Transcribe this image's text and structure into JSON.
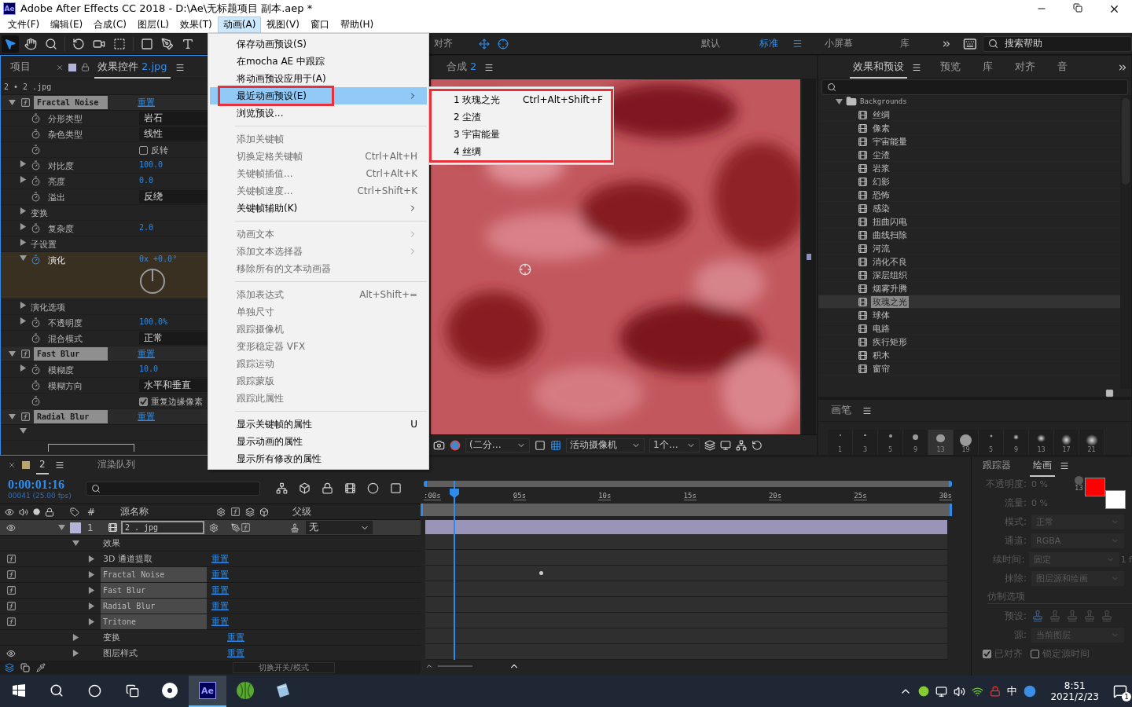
{
  "window": {
    "app_badge": "Ae",
    "title": "Adobe After Effects CC 2018 - D:\\Ae\\无标题项目 副本.aep *"
  },
  "menu_bar": [
    {
      "label": "文件(F)",
      "selected": false
    },
    {
      "label": "编辑(E)",
      "selected": false
    },
    {
      "label": "合成(C)",
      "selected": false
    },
    {
      "label": "图层(L)",
      "selected": false
    },
    {
      "label": "效果(T)",
      "selected": false
    },
    {
      "label": "动画(A)",
      "selected": true
    },
    {
      "label": "视图(V)",
      "selected": false
    },
    {
      "label": "窗口",
      "selected": false
    },
    {
      "label": "帮助(H)",
      "selected": false
    }
  ],
  "toolbar": {
    "workspaces": [
      {
        "label": "默认",
        "selected": false
      },
      {
        "label": "标准",
        "selected": true
      },
      {
        "label": "小屏幕",
        "selected": false
      },
      {
        "label": "库",
        "selected": false
      }
    ],
    "search": {
      "placeholder": "搜索帮助"
    }
  },
  "effect_controls": {
    "tabs": [
      {
        "label": "项目",
        "selected": false
      },
      {
        "label": "效果控件",
        "target": "2.jpg",
        "selected": true
      }
    ],
    "breadcrumb": "2 • 2 .jpg",
    "effects": [
      {
        "name": "Fractal Noise",
        "reset": "重置",
        "props": [
          {
            "kind": "dropdown",
            "label": "分形类型",
            "value": "岩石",
            "stopwatch": true,
            "selected": false
          },
          {
            "kind": "dropdown",
            "label": "杂色类型",
            "value": "线性",
            "stopwatch": true,
            "selected": false
          },
          {
            "kind": "checkbox",
            "value": "反转",
            "checked": false,
            "stopwatch": true,
            "selected": false
          },
          {
            "kind": "number",
            "label": "对比度",
            "value": "100.0",
            "expanded": false,
            "stopwatch": true,
            "selected": false
          },
          {
            "kind": "number",
            "label": "亮度",
            "value": "0.0",
            "expanded": false,
            "stopwatch": true,
            "selected": false
          },
          {
            "kind": "dropdown",
            "label": "溢出",
            "value": "反绕",
            "stopwatch": true,
            "selected": false
          },
          {
            "kind": "group",
            "label": "变换",
            "expanded": false,
            "stopwatch": false,
            "selected": false
          },
          {
            "kind": "number",
            "label": "复杂度",
            "value": "2.0",
            "expanded": false,
            "stopwatch": true,
            "selected": false
          },
          {
            "kind": "group",
            "label": "子设置",
            "expanded": false,
            "stopwatch": false,
            "selected": false
          },
          {
            "kind": "angle",
            "label": "演化",
            "value": "0x +0.0°",
            "expanded": true,
            "stopwatch": true,
            "selected": true
          },
          {
            "kind": "group",
            "label": "演化选项",
            "expanded": false,
            "stopwatch": false,
            "selected": false
          },
          {
            "kind": "number",
            "label": "不透明度",
            "value": "100.0%",
            "expanded": false,
            "stopwatch": true,
            "selected": false
          },
          {
            "kind": "dropdown",
            "label": "混合模式",
            "value": "正常",
            "stopwatch": true,
            "selected": false
          }
        ]
      },
      {
        "name": "Fast Blur",
        "reset": "重置",
        "props": [
          {
            "kind": "number",
            "label": "模糊度",
            "value": "10.0",
            "expanded": false,
            "stopwatch": true,
            "selected": false
          },
          {
            "kind": "dropdown",
            "label": "模糊方向",
            "value": "水平和垂直",
            "stopwatch": true,
            "selected": false
          },
          {
            "kind": "checkbox",
            "value": "重复边缘像素",
            "checked": true,
            "stopwatch": true,
            "selected": false
          }
        ]
      },
      {
        "name": "Radial Blur",
        "reset": "重置",
        "props": [
          {
            "kind": "widget",
            "expanded": true,
            "stopwatch": false,
            "selected": false
          }
        ]
      }
    ]
  },
  "composition": {
    "align_label": "对齐",
    "tab": {
      "label": "合成",
      "target": "2"
    },
    "resolution": "(二分…",
    "camera": "活动摄像机",
    "views": "1个…"
  },
  "animation_menu": {
    "items": [
      {
        "kind": "item",
        "label": "保存动画预设(S)",
        "disabled": false,
        "submenu": false,
        "selected": false,
        "annotated": false
      },
      {
        "kind": "item",
        "label": "在mocha AE 中跟踪",
        "disabled": false,
        "submenu": false,
        "selected": false,
        "annotated": false
      },
      {
        "kind": "item",
        "label": "将动画预设应用于(A)",
        "disabled": false,
        "submenu": false,
        "selected": false,
        "annotated": false
      },
      {
        "kind": "item",
        "label": "最近动画预设(E)",
        "disabled": false,
        "submenu": true,
        "selected": true,
        "annotated": true
      },
      {
        "kind": "item",
        "label": "浏览预设...",
        "disabled": false,
        "submenu": false,
        "selected": false,
        "annotated": false
      },
      {
        "kind": "separator"
      },
      {
        "kind": "item",
        "label": "添加关键帧",
        "disabled": true,
        "submenu": false,
        "selected": false,
        "annotated": false
      },
      {
        "kind": "item",
        "label": "切换定格关键帧",
        "shortcut": "Ctrl+Alt+H",
        "disabled": true,
        "submenu": false,
        "selected": false,
        "annotated": false
      },
      {
        "kind": "item",
        "label": "关键帧插值...",
        "shortcut": "Ctrl+Alt+K",
        "disabled": true,
        "submenu": false,
        "selected": false,
        "annotated": false
      },
      {
        "kind": "item",
        "label": "关键帧速度...",
        "shortcut": "Ctrl+Shift+K",
        "disabled": true,
        "submenu": false,
        "selected": false,
        "annotated": false
      },
      {
        "kind": "item",
        "label": "关键帧辅助(K)",
        "disabled": false,
        "submenu": true,
        "selected": false,
        "annotated": false
      },
      {
        "kind": "separator"
      },
      {
        "kind": "item",
        "label": "动画文本",
        "disabled": true,
        "submenu": true,
        "selected": false,
        "annotated": false
      },
      {
        "kind": "item",
        "label": "添加文本选择器",
        "disabled": true,
        "submenu": true,
        "selected": false,
        "annotated": false
      },
      {
        "kind": "item",
        "label": "移除所有的文本动画器",
        "disabled": true,
        "submenu": false,
        "selected": false,
        "annotated": false
      },
      {
        "kind": "separator"
      },
      {
        "kind": "item",
        "label": "添加表达式",
        "shortcut": "Alt+Shift+=",
        "disabled": true,
        "submenu": false,
        "selected": false,
        "annotated": false
      },
      {
        "kind": "item",
        "label": "单独尺寸",
        "disabled": true,
        "submenu": false,
        "selected": false,
        "annotated": false
      },
      {
        "kind": "item",
        "label": "跟踪摄像机",
        "disabled": true,
        "submenu": false,
        "selected": false,
        "annotated": false
      },
      {
        "kind": "item",
        "label": "变形稳定器 VFX",
        "disabled": true,
        "submenu": false,
        "selected": false,
        "annotated": false
      },
      {
        "kind": "item",
        "label": "跟踪运动",
        "disabled": true,
        "submenu": false,
        "selected": false,
        "annotated": false
      },
      {
        "kind": "item",
        "label": "跟踪蒙版",
        "disabled": true,
        "submenu": false,
        "selected": false,
        "annotated": false
      },
      {
        "kind": "item",
        "label": "跟踪此属性",
        "disabled": true,
        "submenu": false,
        "selected": false,
        "annotated": false
      },
      {
        "kind": "separator"
      },
      {
        "kind": "item",
        "label": "显示关键帧的属性",
        "shortcut": "U",
        "disabled": false,
        "submenu": false,
        "selected": false,
        "annotated": false
      },
      {
        "kind": "item",
        "label": "显示动画的属性",
        "disabled": false,
        "submenu": false,
        "selected": false,
        "annotated": false
      },
      {
        "kind": "item",
        "label": "显示所有修改的属性",
        "disabled": false,
        "submenu": false,
        "selected": false,
        "annotated": false
      }
    ],
    "submenu": {
      "annotated": true,
      "items": [
        {
          "label": "1 玫瑰之光",
          "shortcut": "Ctrl+Alt+Shift+F"
        },
        {
          "label": "2 尘渣"
        },
        {
          "label": "3 宇宙能量"
        },
        {
          "label": "4 丝绸"
        }
      ]
    }
  },
  "effects_presets": {
    "tabs": [
      {
        "label": "效果和预设",
        "selected": true
      },
      {
        "label": "预览",
        "selected": false
      },
      {
        "label": "库",
        "selected": false
      },
      {
        "label": "对齐",
        "selected": false
      },
      {
        "label": "音",
        "selected": false
      }
    ],
    "tree": {
      "label": "Backgrounds",
      "expanded": true,
      "children": [
        {
          "label": "丝绸",
          "selected": false
        },
        {
          "label": "像素",
          "selected": false
        },
        {
          "label": "宇宙能量",
          "selected": false
        },
        {
          "label": "尘渣",
          "selected": false
        },
        {
          "label": "岩浆",
          "selected": false
        },
        {
          "label": "幻影",
          "selected": false
        },
        {
          "label": "恐怖",
          "selected": false
        },
        {
          "label": "感染",
          "selected": false
        },
        {
          "label": "扭曲闪电",
          "selected": false
        },
        {
          "label": "曲线扫除",
          "selected": false
        },
        {
          "label": "河流",
          "selected": false
        },
        {
          "label": "消化不良",
          "selected": false
        },
        {
          "label": "深层组织",
          "selected": false
        },
        {
          "label": "烟雾升腾",
          "selected": false
        },
        {
          "label": "玫瑰之光",
          "selected": true
        },
        {
          "label": "球体",
          "selected": false
        },
        {
          "label": "电路",
          "selected": false
        },
        {
          "label": "疾行矩形",
          "selected": false
        },
        {
          "label": "积木",
          "selected": false
        },
        {
          "label": "窗帘",
          "selected": false
        }
      ]
    }
  },
  "brushes": {
    "title": "画笔",
    "items": [
      {
        "size": "1",
        "kind": "hard",
        "selected": false
      },
      {
        "size": "3",
        "kind": "hard",
        "selected": false
      },
      {
        "size": "5",
        "kind": "hard",
        "selected": false
      },
      {
        "size": "9",
        "kind": "hard",
        "selected": false
      },
      {
        "size": "13",
        "kind": "hard",
        "selected": true
      },
      {
        "size": "19",
        "kind": "hard",
        "selected": false
      },
      {
        "size": "5",
        "kind": "soft",
        "selected": false
      },
      {
        "size": "9",
        "kind": "soft",
        "selected": false
      },
      {
        "size": "13",
        "kind": "soft",
        "selected": false
      },
      {
        "size": "17",
        "kind": "soft",
        "selected": false
      },
      {
        "size": "21",
        "kind": "soft",
        "selected": false
      }
    ]
  },
  "timeline": {
    "tabs": [
      {
        "label": "2",
        "selected": true
      },
      {
        "label": "渲染队列",
        "selected": false
      }
    ],
    "timecode": "0:00:01:16",
    "frame_info": "00041 (25.00 fps)",
    "columns": {
      "number": "#",
      "source": "源名称",
      "parent": "父级"
    },
    "layer": {
      "number": "1",
      "name": "2 . jpg",
      "parent": "无",
      "visible": true,
      "expanded": true
    },
    "rows": [
      {
        "kind": "group",
        "label": "效果",
        "expanded": true,
        "eye": false,
        "dot": false
      },
      {
        "kind": "effect",
        "label": "3D 通道提取",
        "reset": "重置",
        "boxed": false,
        "expanded": false,
        "eye": false,
        "dot": false
      },
      {
        "kind": "effect",
        "label": "Fractal Noise",
        "reset": "重置",
        "boxed": true,
        "expanded": false,
        "eye": false,
        "dot": true
      },
      {
        "kind": "effect",
        "label": "Fast Blur",
        "reset": "重置",
        "boxed": true,
        "expanded": false,
        "eye": false,
        "dot": false
      },
      {
        "kind": "effect",
        "label": "Radial Blur",
        "reset": "重置",
        "boxed": true,
        "expanded": false,
        "eye": false,
        "dot": false
      },
      {
        "kind": "effect",
        "label": "Tritone",
        "reset": "重置",
        "boxed": true,
        "expanded": false,
        "eye": false,
        "dot": false
      },
      {
        "kind": "group",
        "label": "变换",
        "reset": "重置",
        "expanded": false,
        "eye": false,
        "dot": false
      },
      {
        "kind": "group",
        "label": "图层样式",
        "reset": "重置",
        "expanded": false,
        "eye": true,
        "dot": false
      }
    ],
    "ruler": [
      ":00s",
      "05s",
      "10s",
      "15s",
      "20s",
      "25s",
      "30s"
    ],
    "switch_button": "切换开关/模式"
  },
  "paint": {
    "tabs": [
      {
        "label": "跟踪器",
        "selected": false
      },
      {
        "label": "绘画",
        "selected": true
      }
    ],
    "disabled": true,
    "brush_size": "13",
    "swatches": [
      {
        "color": "#ff0000"
      },
      {
        "color": "#ffffff"
      }
    ],
    "fields": [
      {
        "kind": "value",
        "label": "不透明度:",
        "value": "0 %"
      },
      {
        "kind": "value",
        "label": "流量:",
        "value": "0 %"
      },
      {
        "kind": "select",
        "label": "模式:",
        "value": "正常"
      },
      {
        "kind": "select",
        "label": "通道:",
        "value": "RGBA"
      },
      {
        "kind": "select",
        "label": "续时间:",
        "value": "固定",
        "suffix": "1 f"
      },
      {
        "kind": "select",
        "label": "抹除:",
        "value": "图层源和绘画"
      },
      {
        "kind": "heading",
        "label": "仿制选项"
      },
      {
        "kind": "presets",
        "label": "预设:"
      },
      {
        "kind": "select",
        "label": "源:",
        "value": "当前图层"
      }
    ],
    "checks": [
      {
        "label": "已对齐",
        "checked": true
      },
      {
        "label": "锁定源时间",
        "checked": false
      }
    ]
  },
  "taskbar": {
    "apps": [
      {
        "kind": "fan",
        "active": false
      },
      {
        "kind": "ae",
        "label": "Ae",
        "active": true
      },
      {
        "kind": "melon",
        "active": false
      },
      {
        "kind": "notes",
        "active": false
      }
    ],
    "ime": "中",
    "time": "8:51",
    "date": "2021/2/23",
    "notifications": "1"
  }
}
